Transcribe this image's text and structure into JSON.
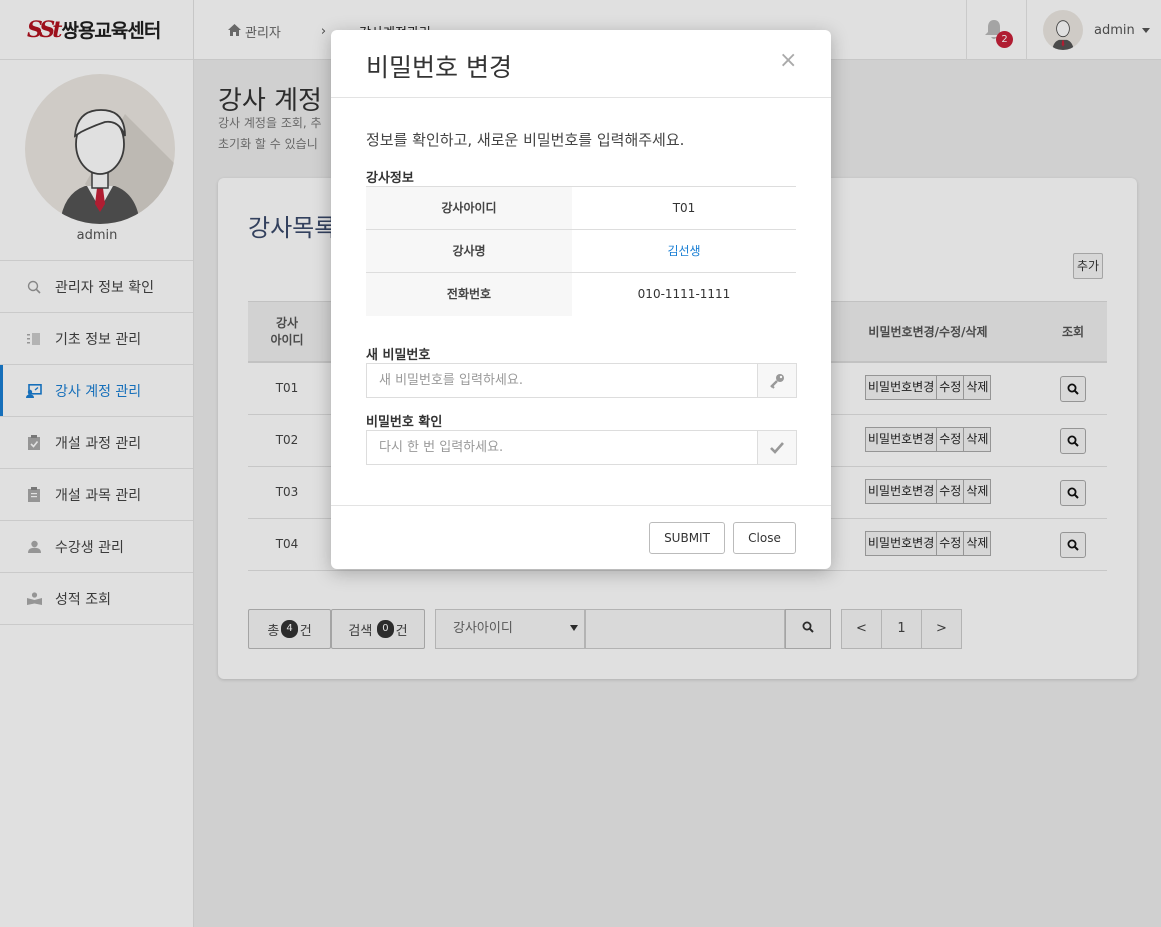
{
  "brand": {
    "logo": "SSt",
    "name": "쌍용교육센터"
  },
  "profile": {
    "name": "admin"
  },
  "sidebar": {
    "items": [
      {
        "label": "관리자 정보 확인",
        "icon": "search-icon"
      },
      {
        "label": "기초 정보 관리",
        "icon": "list-icon"
      },
      {
        "label": "강사 계정 관리",
        "icon": "teacher-icon",
        "active": true
      },
      {
        "label": "개설 과정 관리",
        "icon": "clipboard-check-icon"
      },
      {
        "label": "개설 과목 관리",
        "icon": "clipboard-icon"
      },
      {
        "label": "수강생 관리",
        "icon": "user-icon"
      },
      {
        "label": "성적 조회",
        "icon": "reader-icon"
      }
    ]
  },
  "topbar": {
    "breadcrumb_home": "관리자",
    "breadcrumb_sep": "›",
    "breadcrumb_current": "강사계정관리",
    "notif_count": "2",
    "user": "admin"
  },
  "page": {
    "title": "강사 계정",
    "desc_line1": "강사 계정을 조회, 추",
    "desc_line2": "초기화 할 수 있습니"
  },
  "card": {
    "title": "강사목록",
    "add_label": "추가",
    "headers": {
      "id": "강사\n아이디",
      "actions": "비밀번호변경/수정/삭제",
      "view": "조회"
    },
    "rows": [
      {
        "id": "T01"
      },
      {
        "id": "T02"
      },
      {
        "id": "T03"
      },
      {
        "id": "T04"
      }
    ],
    "row_buttons": {
      "pw": "비밀번호변경",
      "edit": "수정",
      "del": "삭제"
    },
    "footer": {
      "total_prefix": "총",
      "total_count": "4",
      "total_suffix": "건",
      "search_prefix": "검색",
      "search_count": "0",
      "search_suffix": "건",
      "select_value": "강사아이디",
      "pager_prev": "<",
      "pager_page": "1",
      "pager_next": ">"
    }
  },
  "modal": {
    "title": "비밀번호 변경",
    "close": "×",
    "intro": "정보를 확인하고, 새로운 비밀번호를 입력해주세요.",
    "section": "강사정보",
    "info": [
      {
        "key": "강사아이디",
        "value": "T01"
      },
      {
        "key": "강사명",
        "value": "김선생"
      },
      {
        "key": "전화번호",
        "value": "010-1111-1111"
      }
    ],
    "new_pw_label": "새 비밀번호",
    "new_pw_placeholder": "새 비밀번호를 입력하세요.",
    "confirm_pw_label": "비밀번호 확인",
    "confirm_pw_placeholder": "다시 한 번 입력하세요.",
    "submit": "SUBMIT",
    "close_btn": "Close"
  },
  "colors": {
    "accent": "#1a7fd4",
    "badge": "#c9213a",
    "logo": "#b3121f"
  }
}
